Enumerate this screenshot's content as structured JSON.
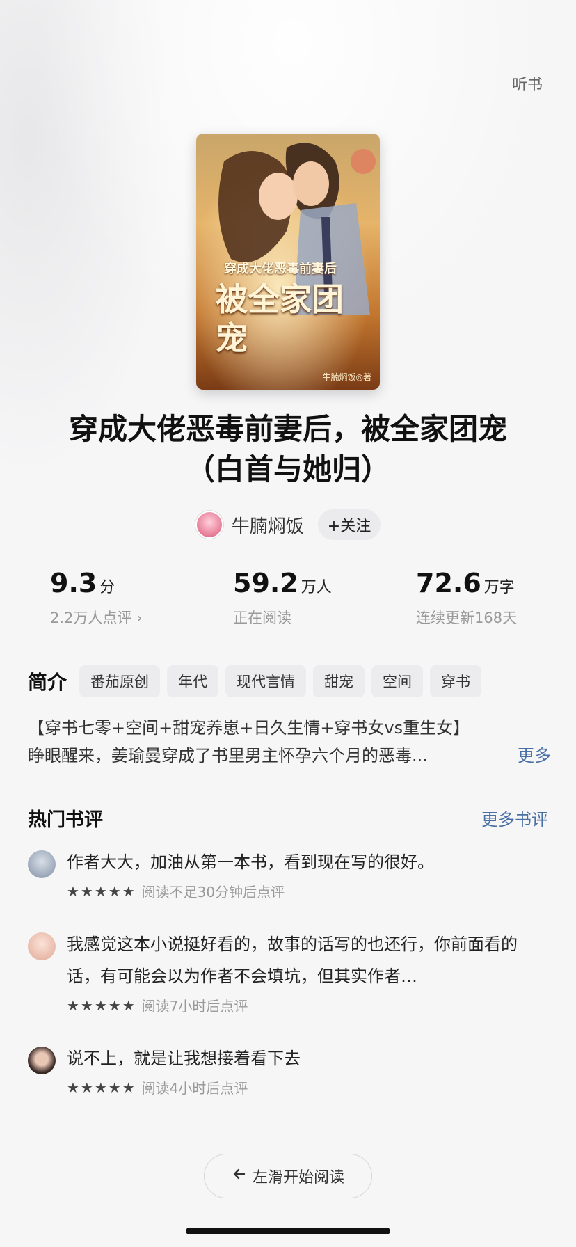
{
  "header": {
    "listen_label": "听书"
  },
  "book": {
    "cover_overlay": {
      "subtitle": "穿成大佬恶毒前妻后",
      "title": "被全家团宠",
      "author": "牛腩焖饭◎著"
    },
    "title": "穿成大佬恶毒前妻后，被全家团宠（白首与她归）"
  },
  "author": {
    "name": "牛腩焖饭",
    "follow_label": "+关注"
  },
  "stats": {
    "rating": {
      "value": "9.3",
      "unit": "分",
      "sub": "2.2万人点评 ›"
    },
    "readers": {
      "value": "59.2",
      "unit": "万人",
      "sub": "正在阅读"
    },
    "words": {
      "value": "72.6",
      "unit": "万字",
      "sub": "连续更新168天"
    }
  },
  "intro": {
    "heading": "简介",
    "tags": [
      "番茄原创",
      "年代",
      "现代言情",
      "甜宠",
      "空间",
      "穿书"
    ],
    "line1": "【穿书七零+空间+甜宠养崽+日久生情+穿书女vs重生女】",
    "line2": "睁眼醒来，姜瑜曼穿成了书里男主怀孕六个月的恶毒...",
    "more": "更多"
  },
  "reviews": {
    "heading": "热门书评",
    "more": "更多书评",
    "items": [
      {
        "text": "作者大大，加油从第一本书，看到现在写的很好。",
        "stars": "★★★★★",
        "meta": "阅读不足30分钟后点评",
        "avatar_color": "#9aa6b8"
      },
      {
        "text": "我感觉这本小说挺好看的，故事的话写的也还行，你前面看的话，有可能会以为作者不会填坑，但其实作者…",
        "stars": "★★★★★",
        "meta": "阅读7小时后点评",
        "avatar_color": "#e8b9a8"
      },
      {
        "text": "说不上，就是让我想接着看下去",
        "stars": "★★★★★",
        "meta": "阅读4小时后点评",
        "avatar_color": "#3a2a26"
      }
    ]
  },
  "footer": {
    "start_label": "左滑开始阅读"
  }
}
